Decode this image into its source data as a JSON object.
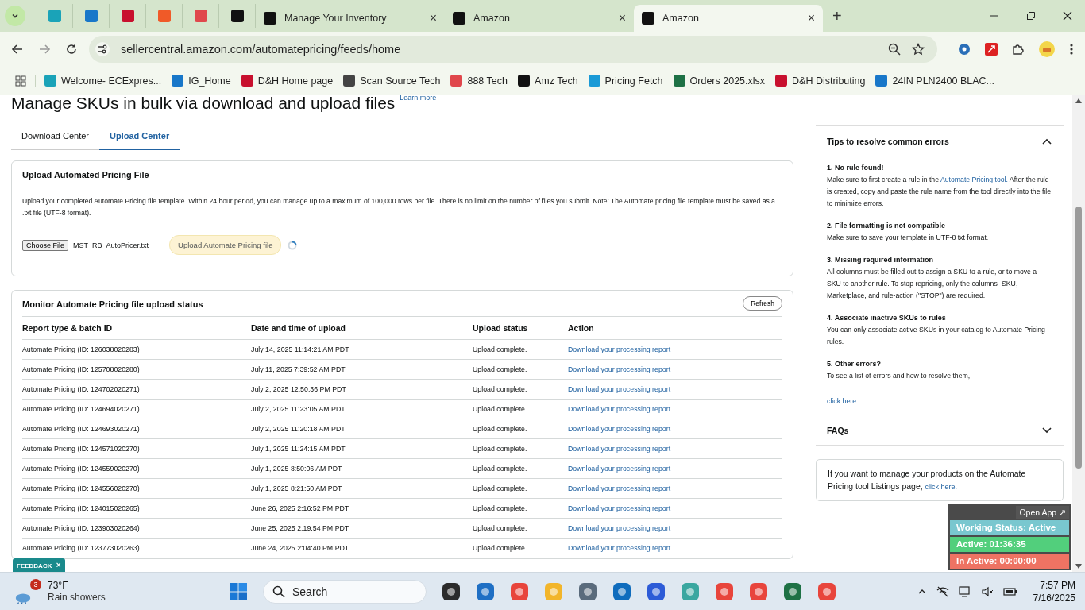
{
  "browser": {
    "tabs": [
      {
        "title": "Manage Your Inventory",
        "close": "×",
        "selected": false
      },
      {
        "title": "Amazon",
        "close": "×",
        "selected": false
      },
      {
        "title": "Amazon",
        "close": "×",
        "selected": true
      }
    ],
    "new_tab": "+",
    "address": "sellercentral.amazon.com/automatepricing/feeds/home",
    "bookmarks": [
      "Welcome- ECExpres...",
      "IG_Home",
      "D&H Home page",
      "Scan Source Tech",
      "888 Tech",
      "Amz Tech",
      "Pricing Fetch",
      "Orders 2025.xlsx",
      "D&H Distributing",
      "24IN PLN2400 BLAC..."
    ]
  },
  "page": {
    "title": "Manage SKUs in bulk via download and upload files",
    "learn_more": "Learn more",
    "tabs": [
      {
        "label": "Download Center",
        "selected": false
      },
      {
        "label": "Upload Center",
        "selected": true
      }
    ],
    "upload_card": {
      "title": "Upload Automated Pricing File",
      "description": "Upload your completed Automate Pricing file template. Within 24 hour period, you can manage up to a maximum of 100,000 rows per file. There is no limit on the number of files you submit. Note: The Automate pricing file template must be saved as a .txt file (UTF-8 format).",
      "choose_button": "Choose File",
      "file_name": "MST_RB_AutoPricer.txt",
      "upload_button": "Upload Automate Pricing file",
      "uploading": true
    },
    "monitor": {
      "title": "Monitor Automate Pricing file upload status",
      "refresh": "Refresh",
      "columns": [
        "Report type & batch ID",
        "Date and time of upload",
        "Upload status",
        "Action"
      ],
      "rows": [
        [
          "Automate Pricing (ID: 126038020283)",
          "July 14, 2025 11:14:21 AM PDT",
          "Upload complete.",
          "Download your processing report"
        ],
        [
          "Automate Pricing (ID: 125708020280)",
          "July 11, 2025 7:39:52 AM PDT",
          "Upload complete.",
          "Download your processing report"
        ],
        [
          "Automate Pricing (ID: 124702020271)",
          "July 2, 2025 12:50:36 PM PDT",
          "Upload complete.",
          "Download your processing report"
        ],
        [
          "Automate Pricing (ID: 124694020271)",
          "July 2, 2025 11:23:05 AM PDT",
          "Upload complete.",
          "Download your processing report"
        ],
        [
          "Automate Pricing (ID: 124693020271)",
          "July 2, 2025 11:20:18 AM PDT",
          "Upload complete.",
          "Download your processing report"
        ],
        [
          "Automate Pricing (ID: 124571020270)",
          "July 1, 2025 11:24:15 AM PDT",
          "Upload complete.",
          "Download your processing report"
        ],
        [
          "Automate Pricing (ID: 124559020270)",
          "July 1, 2025 8:50:06 AM PDT",
          "Upload complete.",
          "Download your processing report"
        ],
        [
          "Automate Pricing (ID: 124556020270)",
          "July 1, 2025 8:21:50 AM PDT",
          "Upload complete.",
          "Download your processing report"
        ],
        [
          "Automate Pricing (ID: 124015020265)",
          "June 26, 2025 2:16:52 PM PDT",
          "Upload complete.",
          "Download your processing report"
        ],
        [
          "Automate Pricing (ID: 123903020264)",
          "June 25, 2025 2:19:54 PM PDT",
          "Upload complete.",
          "Download your processing report"
        ],
        [
          "Automate Pricing (ID: 123773020263)",
          "June 24, 2025 2:04:40 PM PDT",
          "Upload complete.",
          "Download your processing report"
        ]
      ]
    }
  },
  "sidebar": {
    "tips": {
      "title": "Tips to resolve common errors",
      "expanded": true,
      "items": [
        {
          "heading": "1. No rule found!",
          "text": "Make sure to first create a rule in the ",
          "link": "Automate Pricing tool.",
          "after": "  After the rule is created, copy and paste the rule name from the tool directly into the file to minimize errors."
        },
        {
          "heading": "2. File formatting is not compatible",
          "text": "Make sure to save your template in UTF-8 txt format."
        },
        {
          "heading": "3. Missing required information",
          "text": "All columns must be filled out to assign a SKU to a rule, or to move a SKU to another rule. To stop repricing, only the columns- SKU, Marketplace, and rule-action (\"STOP\") are required."
        },
        {
          "heading": "4. Associate inactive SKUs to rules",
          "text": "You can only associate active SKUs in your catalog to Automate Pricing rules."
        },
        {
          "heading": "5. Other errors?",
          "text": "To see a list of errors and how to resolve them,"
        }
      ],
      "link": "click here."
    },
    "faqs": {
      "title": "FAQs",
      "expanded": false
    },
    "note": {
      "text": "If you want to manage your products on the Automate Pricing tool Listings page, ",
      "link": "click here."
    }
  },
  "feedback": {
    "label": "FEEDBACK",
    "close": "×"
  },
  "widget": {
    "open_app": "Open App ↗",
    "statuses": [
      {
        "text": "Working Status: Active",
        "color": "#79c7cf"
      },
      {
        "text": "Active: 01:36:35",
        "color": "#52cf7c"
      },
      {
        "text": "In Active: 00:00:00",
        "color": "#ee7363"
      }
    ]
  },
  "taskbar": {
    "weather": {
      "badge": "3",
      "temp": "73°F",
      "condition": "Rain showers"
    },
    "search": {
      "placeholder": "Search"
    },
    "time": "7:57 PM",
    "date": "7/16/2025"
  }
}
